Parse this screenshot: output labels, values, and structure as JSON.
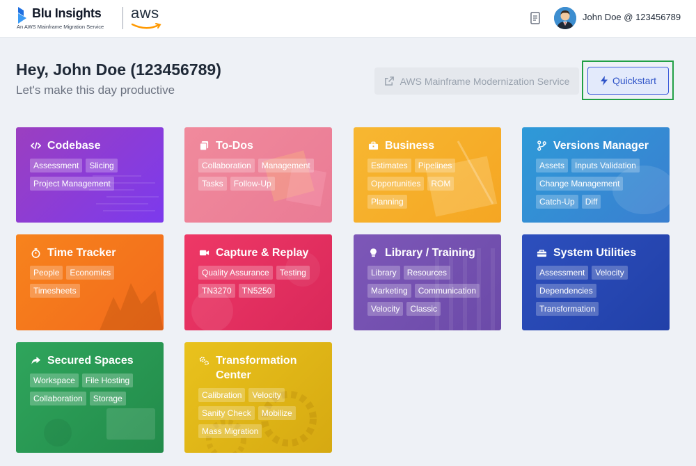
{
  "header": {
    "brand": "Blu Insights",
    "brand_subtitle": "An AWS Mainframe Migration Service",
    "partner_logo": "aws",
    "user_label": "John Doe @ 123456789",
    "icons": {
      "docs": "document-icon",
      "avatar": "user-avatar"
    }
  },
  "greeting": {
    "title": "Hey, John Doe (123456789)",
    "subtitle": "Let's make this day productive"
  },
  "actions": {
    "aws_service": "AWS Mainframe Modernization Service",
    "quickstart": "Quickstart"
  },
  "colors": {
    "quickstart_border": "#3b5bdb",
    "highlight": "#22a045"
  },
  "cards": [
    {
      "title": "Codebase",
      "icon": "code-icon",
      "tags": [
        "Assessment",
        "Slicing",
        "Project Management"
      ]
    },
    {
      "title": "To-Dos",
      "icon": "copy-icon",
      "tags": [
        "Collaboration",
        "Management",
        "Tasks",
        "Follow-Up"
      ]
    },
    {
      "title": "Business",
      "icon": "briefcase-icon",
      "tags": [
        "Estimates",
        "Pipelines",
        "Opportunities",
        "ROM",
        "Planning"
      ]
    },
    {
      "title": "Versions Manager",
      "icon": "branch-icon",
      "tags": [
        "Assets",
        "Inputs Validation",
        "Change Management",
        "Catch-Up",
        "Diff"
      ]
    },
    {
      "title": "Time Tracker",
      "icon": "stopwatch-icon",
      "tags": [
        "People",
        "Economics",
        "Timesheets"
      ]
    },
    {
      "title": "Capture & Replay",
      "icon": "video-icon",
      "tags": [
        "Quality Assurance",
        "Testing",
        "TN3270",
        "TN5250"
      ]
    },
    {
      "title": "Library / Training",
      "icon": "lightbulb-icon",
      "tags": [
        "Library",
        "Resources",
        "Marketing",
        "Communication",
        "Velocity",
        "Classic"
      ]
    },
    {
      "title": "System Utilities",
      "icon": "toolbox-icon",
      "tags": [
        "Assessment",
        "Velocity",
        "Dependencies",
        "Transformation"
      ]
    },
    {
      "title": "Secured Spaces",
      "icon": "share-icon",
      "tags": [
        "Workspace",
        "File Hosting",
        "Collaboration",
        "Storage"
      ]
    },
    {
      "title": "Transformation Center",
      "icon": "gears-icon",
      "tags": [
        "Calibration",
        "Velocity",
        "Sanity Check",
        "Mobilize",
        "Mass Migration"
      ]
    }
  ]
}
